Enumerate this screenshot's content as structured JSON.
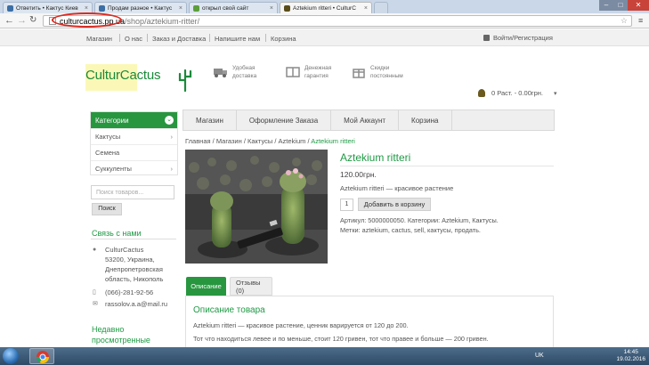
{
  "browser": {
    "tabs": [
      {
        "title": "Ответить • Кактус Киев",
        "favicon": "#3b6ea5"
      },
      {
        "title": "Продам разное • Кактус",
        "favicon": "#3b6ea5"
      },
      {
        "title": "открыл свой сайт",
        "favicon": "#5b9e3a"
      },
      {
        "title": "Aztekium ritteri • CulturC",
        "favicon": "#5a4d1a"
      }
    ],
    "url_domain": "culturcactus.pp.ua",
    "url_path": "/shop/aztekium-ritter/"
  },
  "topnav": {
    "links": [
      "Магазин",
      "О нас",
      "Заказ и Доставка",
      "Напишите нам",
      "Корзина"
    ],
    "login": "Войти/Регистрация"
  },
  "header": {
    "logo": "CulturCactus",
    "features": [
      {
        "line1": "Удобная",
        "line2": "доставка",
        "icon": "truck-icon"
      },
      {
        "line1": "Денежная",
        "line2": "гарантия",
        "icon": "book-icon"
      },
      {
        "line1": "Скидки",
        "line2": "постоянным",
        "icon": "gift-icon"
      }
    ],
    "cart_summary": "0 Раст. - 0.00грн."
  },
  "sidebar": {
    "categories_title": "Категории",
    "categories": [
      "Кактусы",
      "Семена",
      "Суккуленты"
    ],
    "search_placeholder": "Поиск товаров...",
    "search_button": "Поиск",
    "contact_title": "Связь с нами",
    "contact": {
      "address": [
        "CulturCactus",
        "53200, Украина,",
        "Днепропетровская",
        "область, Никополь"
      ],
      "phone": "(066)-281-92-56",
      "email": "rassolov.a.a@mail.ru"
    },
    "recent_title": [
      "Недавно",
      "просмотренные"
    ]
  },
  "mainmenu": [
    "Магазин",
    "Оформление Заказа",
    "Мой Аккаунт",
    "Корзина"
  ],
  "breadcrumb": {
    "items": [
      "Главная",
      "Магазин",
      "Кактусы",
      "Aztekium"
    ],
    "current": "Aztekium ritteri"
  },
  "product": {
    "title": "Aztekium ritteri",
    "price": "120.00грн.",
    "short_desc": "Aztekium ritteri — красивое растение",
    "qty": "1",
    "add_to_cart": "Добавить в корзину",
    "meta_line1": "Артикул: 5000000050. Категории: Aztekium, Кактусы.",
    "meta_line2": "Метки: aztekium, cactus, sell, кактусы, продать."
  },
  "tabs": {
    "description": "Описание",
    "reviews": "Отзывы (0)",
    "desc_heading": "Описание товара",
    "desc_p1": "Aztekium ritteri — красивое растение, ценник варируется от 120 до 200.",
    "desc_p2": "Тот что находиться левее и по меньше, стоит 120 гривен, тот что правее и больше — 200 гривен."
  },
  "taskbar": {
    "lang": "UK",
    "time": "14:45",
    "date": "19.02.2016"
  },
  "colors": {
    "brand_green": "#27963f",
    "highlight_oval": "#d62b22"
  }
}
